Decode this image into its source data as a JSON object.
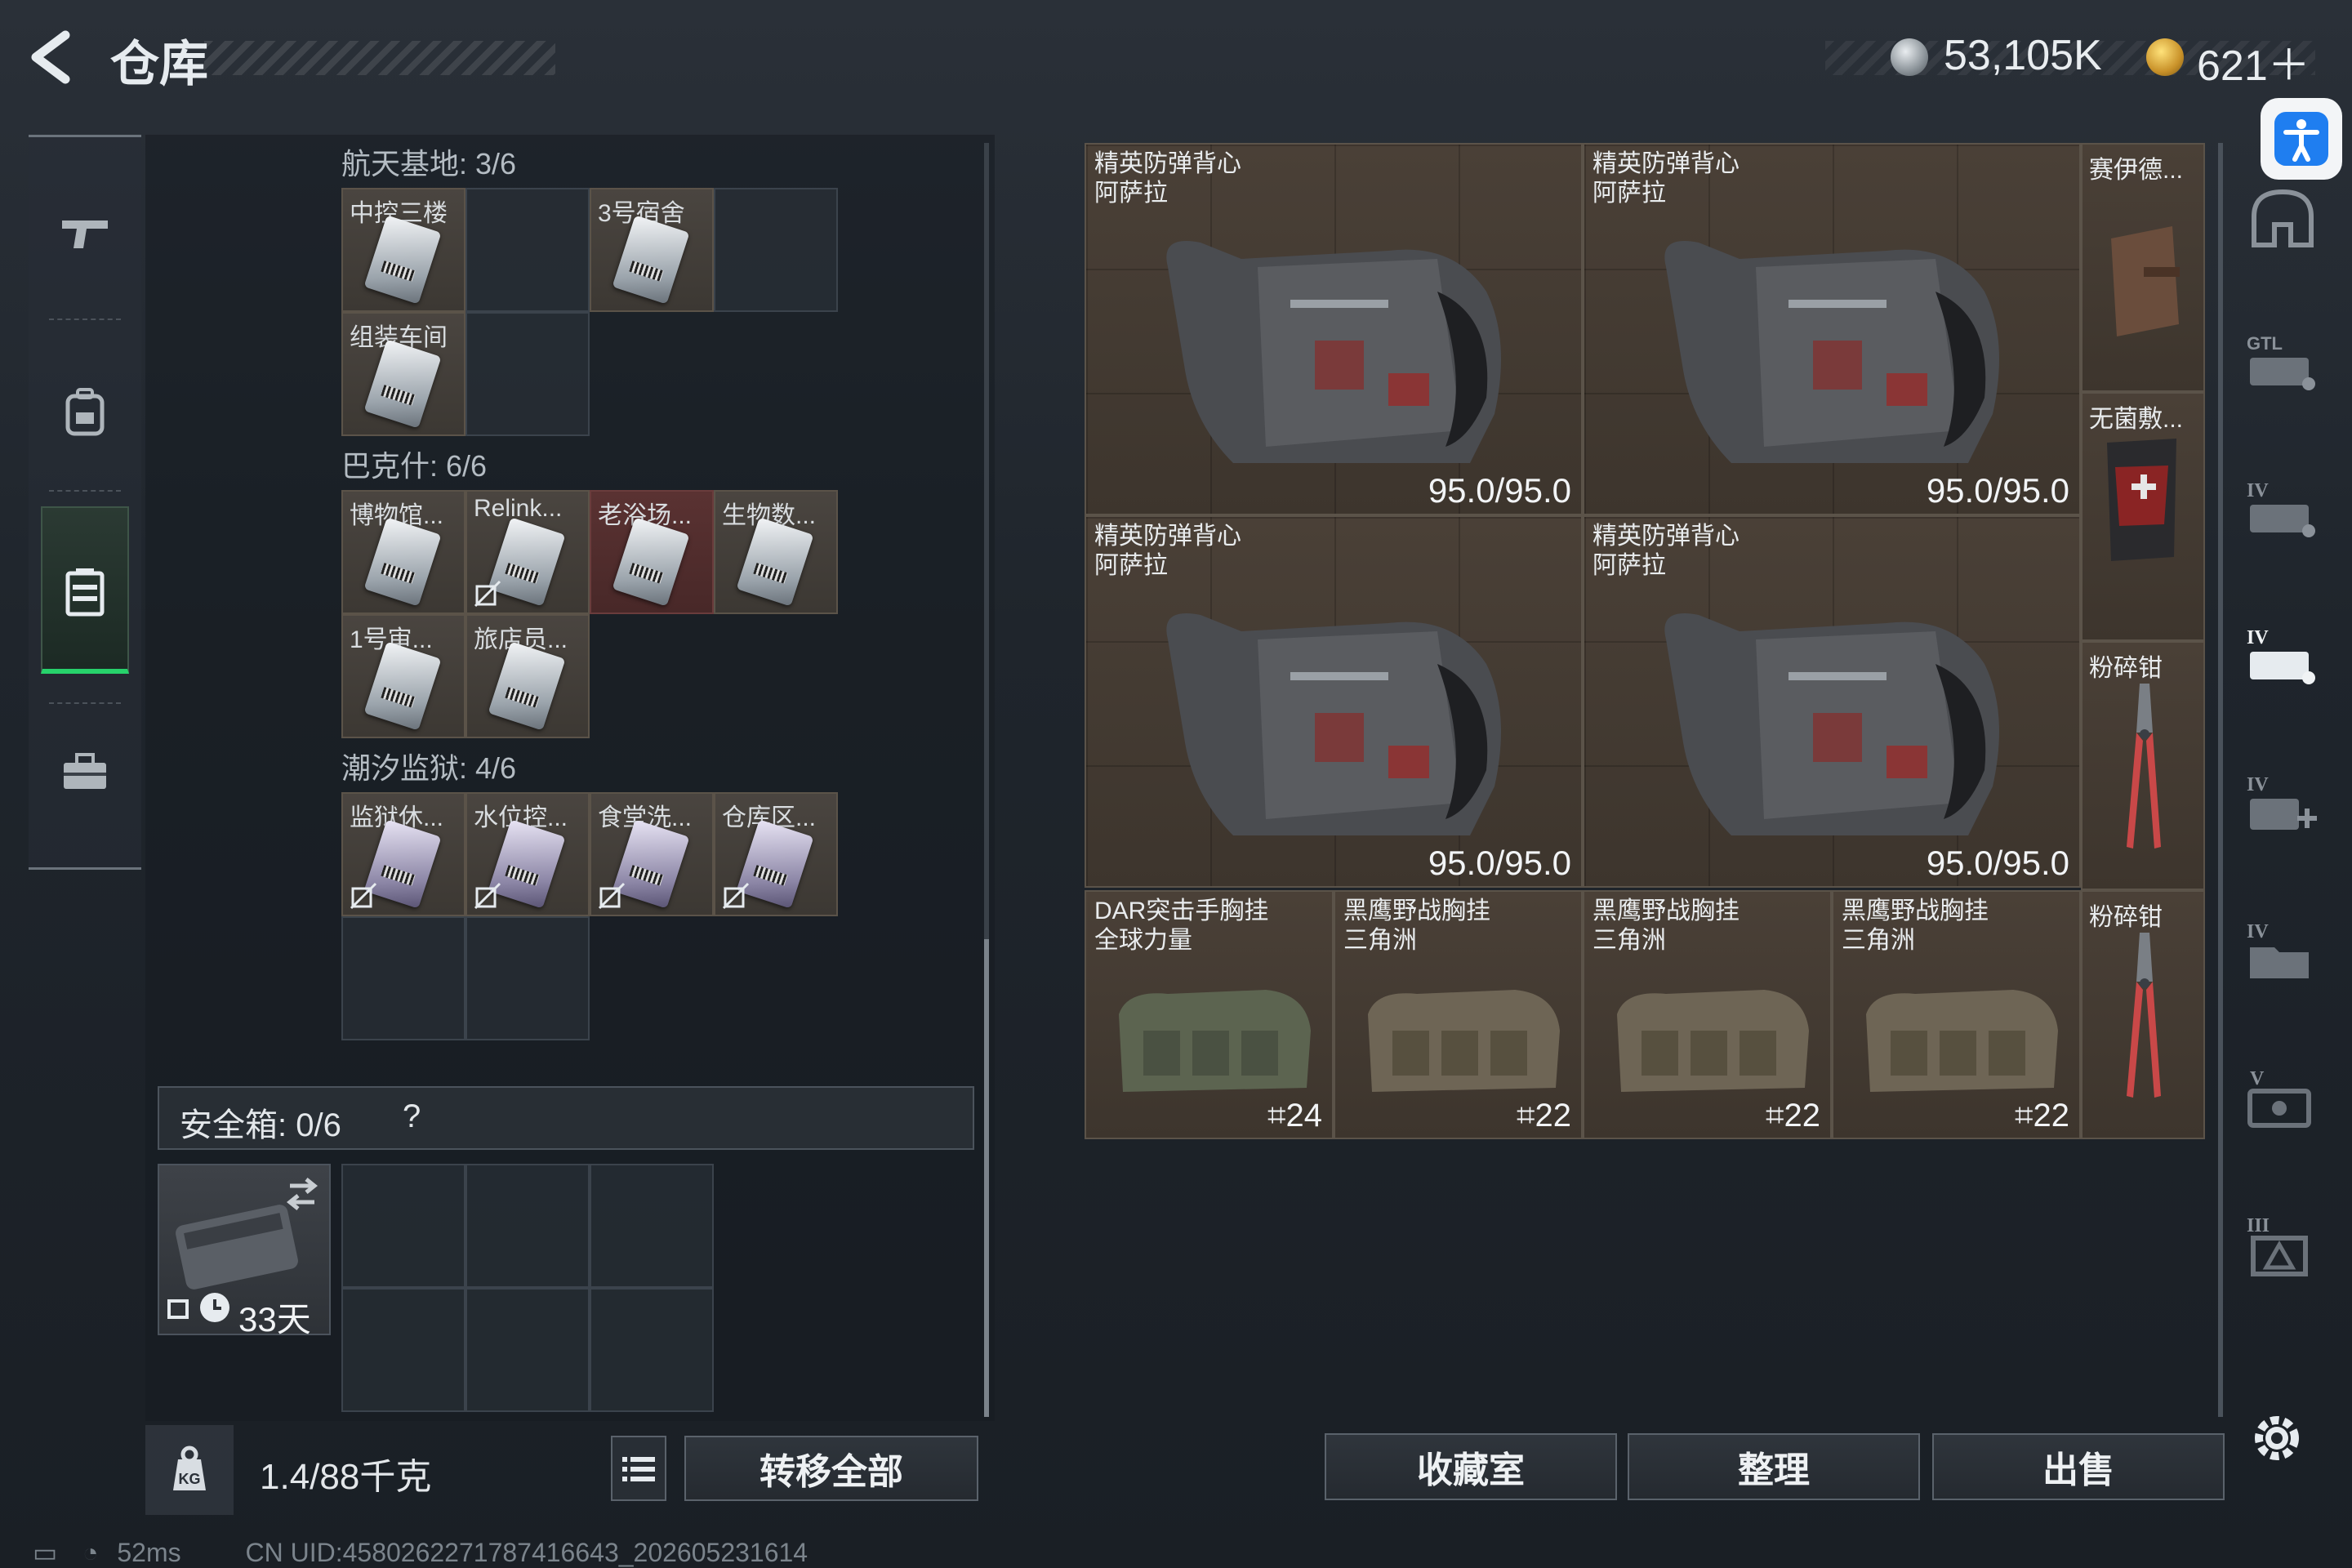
{
  "header": {
    "title": "仓库",
    "currency1": "53,105K",
    "currency2": "621＋"
  },
  "icons": {
    "back": "back-arrow-icon",
    "coin1": "silver-coin-icon",
    "coin2": "gold-coin-icon",
    "accessibility": "accessibility-icon",
    "nav": [
      "gun-icon",
      "backpack-icon",
      "storage-case-icon",
      "toolbox-icon"
    ],
    "right_categories": [
      "helmet-icon",
      "gtl-case-icon",
      "iv-case-icon",
      "iv-case-active-icon",
      "iv-case-plus-icon",
      "iv-folder-icon",
      "v-safe-icon",
      "iii-triangle-icon"
    ],
    "settings": "gear-icon"
  },
  "left": {
    "sections": [
      {
        "label": "航天基地: 3/6",
        "cells": [
          {
            "label": "中控三楼",
            "state": "filled"
          },
          {
            "label": "",
            "state": "empty"
          },
          {
            "label": "3号宿舍",
            "state": "filled"
          },
          {
            "label": "",
            "state": "empty"
          },
          {
            "label": "组装车间",
            "state": "filled"
          },
          {
            "label": "",
            "state": "empty"
          }
        ]
      },
      {
        "label": "巴克什: 6/6",
        "cells": [
          {
            "label": "博物馆...",
            "state": "item"
          },
          {
            "label": "Relink...",
            "state": "item",
            "unlinked": true
          },
          {
            "label": "老浴场...",
            "state": "item-red"
          },
          {
            "label": "生物数...",
            "state": "item"
          },
          {
            "label": "1号审...",
            "state": "item"
          },
          {
            "label": "旅店员...",
            "state": "item"
          }
        ]
      },
      {
        "label": "潮汐监狱: 4/6",
        "cells": [
          {
            "label": "监狱休...",
            "state": "item",
            "unlinked": true
          },
          {
            "label": "水位控...",
            "state": "item",
            "unlinked": true
          },
          {
            "label": "食堂洗...",
            "state": "item",
            "unlinked": true
          },
          {
            "label": "仓库区...",
            "state": "item",
            "unlinked": true
          },
          {
            "label": "",
            "state": "empty"
          },
          {
            "label": "",
            "state": "empty"
          }
        ]
      }
    ],
    "safe": {
      "label": "安全箱: 0/6",
      "help": "?",
      "days": "33天"
    },
    "weight": "1.4/88千克",
    "transfer_all": "转移全部"
  },
  "right": {
    "vests": [
      {
        "name1": "精英防弹背心",
        "name2": "阿萨拉",
        "durability": "95.0/95.0"
      },
      {
        "name1": "精英防弹背心",
        "name2": "阿萨拉",
        "durability": "95.0/95.0"
      },
      {
        "name1": "精英防弹背心",
        "name2": "阿萨拉",
        "durability": "95.0/95.0"
      },
      {
        "name1": "精英防弹背心",
        "name2": "阿萨拉",
        "durability": "95.0/95.0"
      }
    ],
    "rigs": [
      {
        "name1": "DAR突击手胸挂",
        "name2": "全球力量",
        "capacity": "24",
        "color": "#5c6450"
      },
      {
        "name1": "黑鹰野战胸挂",
        "name2": "三角洲",
        "capacity": "22",
        "color": "#6e6555"
      },
      {
        "name1": "黑鹰野战胸挂",
        "name2": "三角洲",
        "capacity": "22",
        "color": "#6e6555"
      },
      {
        "name1": "黑鹰野战胸挂",
        "name2": "三角洲",
        "capacity": "22",
        "color": "#6e6555"
      }
    ],
    "small_items": [
      {
        "name": "赛伊德..."
      },
      {
        "name": "无菌敷..."
      },
      {
        "name": "粉碎钳"
      },
      {
        "name": "粉碎钳"
      }
    ],
    "buttons": {
      "collection": "收藏室",
      "sort": "整理",
      "sell": "出售"
    }
  },
  "status": {
    "ping": "52ms",
    "uid": "CN UID:4580262271787416643_202605231614"
  }
}
